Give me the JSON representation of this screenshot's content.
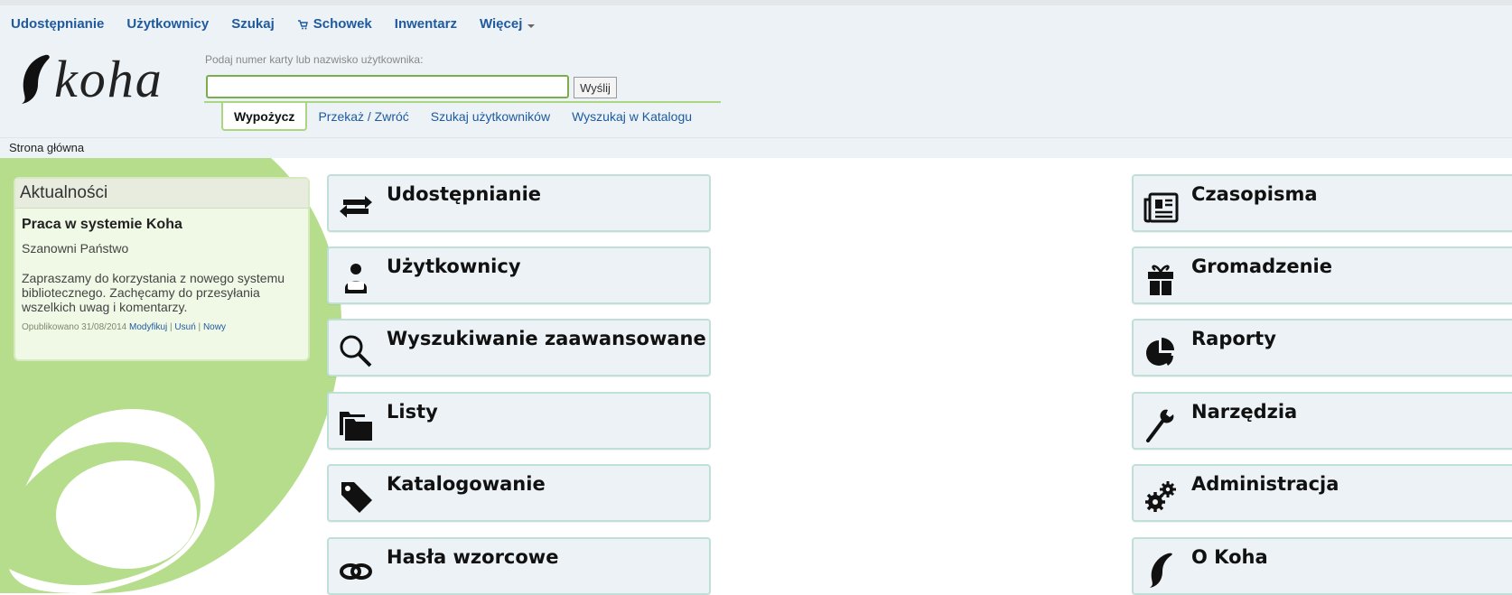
{
  "nav": {
    "items": [
      {
        "label": "Udostępnianie"
      },
      {
        "label": "Użytkownicy"
      },
      {
        "label": "Szukaj"
      },
      {
        "label": "Schowek",
        "icon": "cart-icon"
      },
      {
        "label": "Inwentarz"
      },
      {
        "label": "Więcej",
        "icon": "caret-down-icon"
      }
    ]
  },
  "logo": {
    "text": "koha"
  },
  "checkout": {
    "label": "Podaj numer karty lub nazwisko użytkownika:",
    "value": "",
    "submit_label": "Wyślij",
    "tabs": [
      {
        "label": "Wypożycz",
        "active": true
      },
      {
        "label": "Przekaż / Zwróć"
      },
      {
        "label": "Szukaj użytkowników"
      },
      {
        "label": "Wyszukaj w Katalogu"
      }
    ]
  },
  "breadcrumb": "Strona główna",
  "news": {
    "title": "Aktualności",
    "item": {
      "title": "Praca w systemie Koha",
      "greeting": "Szanowni Państwo",
      "text": "Zapraszamy do korzystania z nowego systemu bibliotecznego. Zachęcamy do przesyłania wszelkich uwag i komentarzy.",
      "published": "Opublikowano 31/08/2014",
      "links": [
        "Modyfikuj",
        "Usuń",
        "Nowy"
      ],
      "separator": "|"
    }
  },
  "modules_left": [
    {
      "label": "Udostępnianie",
      "icon": "circulation-arrows-icon"
    },
    {
      "label": "Użytkownicy",
      "icon": "patron-icon"
    },
    {
      "label": "Wyszukiwanie zaawansowane",
      "icon": "magnifier-icon"
    },
    {
      "label": "Listy",
      "icon": "folders-icon"
    },
    {
      "label": "Katalogowanie",
      "icon": "tag-icon"
    },
    {
      "label": "Hasła wzorcowe",
      "icon": "chain-link-icon"
    }
  ],
  "modules_right": [
    {
      "label": "Czasopisma",
      "icon": "newspaper-icon"
    },
    {
      "label": "Gromadzenie",
      "icon": "gift-icon"
    },
    {
      "label": "Raporty",
      "icon": "pie-chart-icon"
    },
    {
      "label": "Narzędzia",
      "icon": "wrench-icon"
    },
    {
      "label": "Administracja",
      "icon": "gears-icon"
    },
    {
      "label": "O Koha",
      "icon": "koha-leaf-icon"
    }
  ],
  "colors": {
    "header_bg": "#ecf2f5",
    "link": "#1f5aa0",
    "accent_green": "#a9d67e",
    "tile_border": "#bfe0d9"
  }
}
